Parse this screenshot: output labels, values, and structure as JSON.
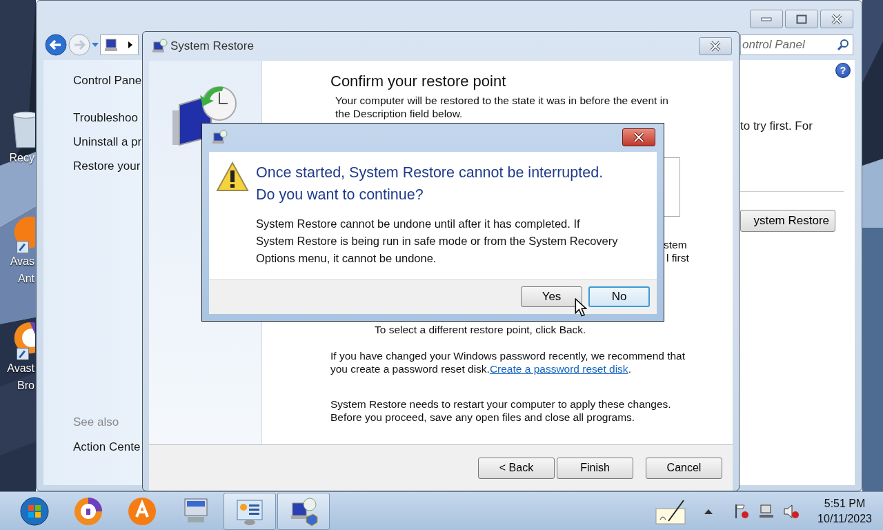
{
  "desktop_icons": [
    {
      "kind": "recycle-bin",
      "lines": [
        "Recy"
      ]
    },
    {
      "kind": "avast",
      "lines": [
        "Avas",
        "Ant"
      ]
    },
    {
      "kind": "avast-browser",
      "lines": [
        "Avast",
        "Bro"
      ]
    }
  ],
  "control_panel": {
    "search": {
      "placeholder": "ontrol Panel"
    },
    "links": [
      "Control Pane",
      "Troubleshoo",
      "Uninstall a pr",
      "Restore your"
    ],
    "see_also": "See also",
    "see_also_links": [
      "Action Cente"
    ],
    "help_label": "?",
    "content_text": "to try first. For",
    "content_button": "ystem Restore"
  },
  "wizard": {
    "title": "System Restore",
    "heading": "Confirm your restore point",
    "intro_lines": [
      "Your computer will be restored to the state it was in before the event in",
      "the Description field below."
    ],
    "fragments": [
      "stem",
      "l first"
    ],
    "back_hint": "To select a different restore point, click Back.",
    "password_lines": [
      "If you have changed your Windows password recently, we recommend that",
      "you create a password reset disk. "
    ],
    "password_link": "Create a password reset disk",
    "password_end": ".",
    "restart_lines": [
      "System Restore needs to restart your computer to apply these changes.",
      "Before you proceed, save any open files and close all programs."
    ],
    "buttons": [
      "< Back",
      "Finish",
      "Cancel"
    ]
  },
  "dialog": {
    "heading_lines": [
      "Once started, System Restore cannot be interrupted.",
      "Do you want to continue?"
    ],
    "message_lines": [
      "System Restore cannot be undone until after it has completed. If",
      "System Restore is being run in safe mode or from the System Recovery",
      "Options menu, it cannot be undone."
    ],
    "buttons": [
      {
        "label": "Yes",
        "focused": false
      },
      {
        "label": "No",
        "focused": true
      }
    ]
  },
  "taskbar": {
    "items": [
      {
        "kind": "start",
        "open": false
      },
      {
        "kind": "avast-browser",
        "open": false
      },
      {
        "kind": "avast",
        "open": false
      },
      {
        "kind": "computer",
        "open": false
      },
      {
        "kind": "control-panel",
        "open": true
      },
      {
        "kind": "restore",
        "open": true
      }
    ],
    "time": "5:51 PM",
    "date": "10/11/2023"
  }
}
